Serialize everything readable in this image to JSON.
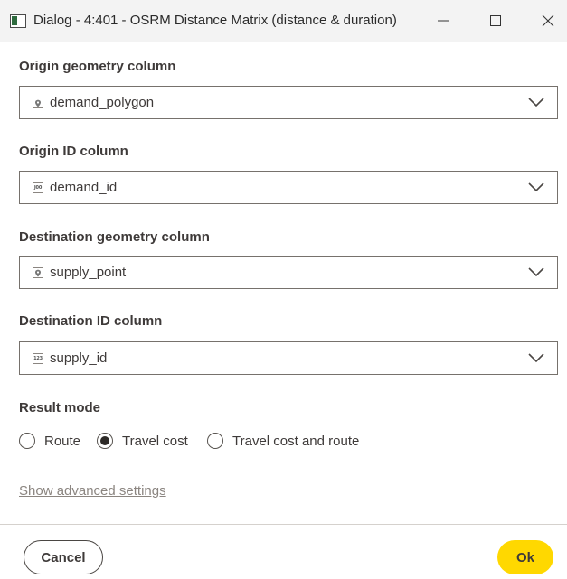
{
  "window": {
    "title": "Dialog - 4:401 - OSRM Distance Matrix (distance & duration)",
    "controls": [
      "minimize",
      "maximize",
      "close"
    ]
  },
  "fields": [
    {
      "label": "Origin geometry column",
      "value": "demand_polygon",
      "type_icon": "geometry-icon"
    },
    {
      "label": "Origin ID column",
      "value": "demand_id",
      "type_icon": "json-type-icon",
      "type_text": "J00"
    },
    {
      "label": "Destination geometry column",
      "value": "supply_point",
      "type_icon": "geometry-icon"
    },
    {
      "label": "Destination ID column",
      "value": "supply_id",
      "type_icon": "number-type-icon",
      "type_text": "123"
    }
  ],
  "result_mode": {
    "label": "Result mode",
    "options": [
      "Route",
      "Travel cost",
      "Travel cost and route"
    ],
    "selected": "Travel cost"
  },
  "advanced_link": "Show advanced settings",
  "footer": {
    "cancel": "Cancel",
    "ok": "Ok"
  },
  "colors": {
    "ok_accent": "#ffd800",
    "text": "#3e3a39",
    "link": "#8b8580"
  }
}
